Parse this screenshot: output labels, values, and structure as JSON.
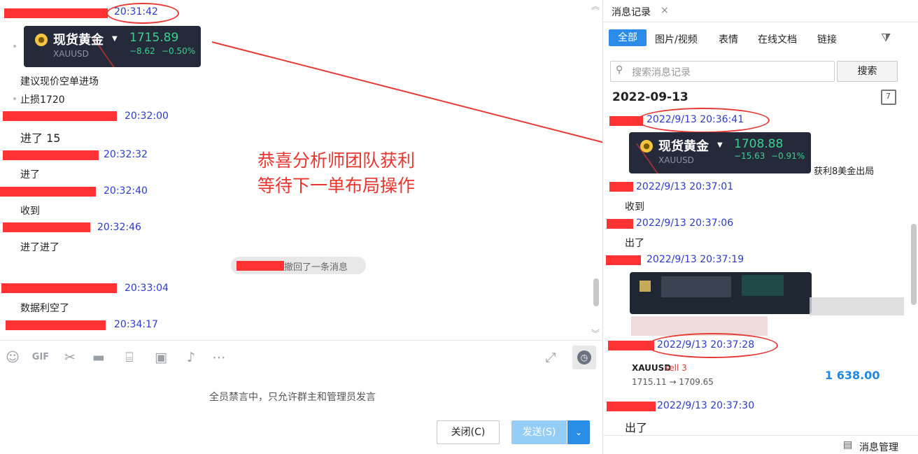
{
  "chat": {
    "first_time": "20:31:42",
    "quote_card_1": {
      "name": "现货黄金",
      "symbol": "XAUUSD",
      "price": "1715.89",
      "change": "−8.62",
      "change_pct": "−0.50%"
    },
    "messages": [
      {
        "text": "建议现价空单进场"
      },
      {
        "text": "止损1720"
      },
      {
        "time": "20:32:00",
        "text": "进了 15"
      },
      {
        "time": "20:32:32",
        "text": "进了"
      },
      {
        "time": "20:32:40",
        "text": "收到"
      },
      {
        "time": "20:32:46",
        "text": "进了进了"
      },
      {
        "time": "20:33:04",
        "text": "数据利空了"
      },
      {
        "time": "20:34:17"
      }
    ],
    "recall_notice": "撤回了一条消息",
    "muted_notice": "全员禁言中，只允许群主和管理员发言",
    "close_button": "关闭(C)",
    "send_button": "发送(S)",
    "toolbar_icons": [
      "emoji-icon",
      "gif-icon",
      "scissors-icon",
      "folder-icon",
      "doc-icon",
      "image-icon",
      "bell-icon",
      "more-icon"
    ]
  },
  "annotation": {
    "line1": "恭喜分析师团队获利",
    "line2": "等待下一单布局操作"
  },
  "history": {
    "tab_title": "消息记录",
    "filters": [
      "全部",
      "图片/视频",
      "表情",
      "在线文档",
      "链接"
    ],
    "search_placeholder": "搜索消息记录",
    "search_button": "搜索",
    "date_header": "2022-09-13",
    "calendar_day": "7",
    "quote_card_2": {
      "name": "现货黄金",
      "symbol": "XAUUSD",
      "price": "1708.88",
      "change": "−15.63",
      "change_pct": "−0.91%"
    },
    "profit_note": "获利8美金出局",
    "entries": [
      {
        "time": "2022/9/13 20:36:41"
      },
      {
        "time": "2022/9/13 20:37:01",
        "text": "收到"
      },
      {
        "time": "2022/9/13 20:37:06",
        "text": "出了"
      },
      {
        "time": "2022/9/13 20:37:19"
      },
      {
        "time": "2022/9/13 20:37:28"
      },
      {
        "time": "2022/9/13 20:37:30",
        "text": "出了"
      }
    ],
    "trade_card": {
      "symbol": "XAUUSD",
      "side": "sell 3",
      "prices": "1715.11 → 1709.65",
      "profit": "1 638.00"
    },
    "manage_label": "消息管理"
  }
}
